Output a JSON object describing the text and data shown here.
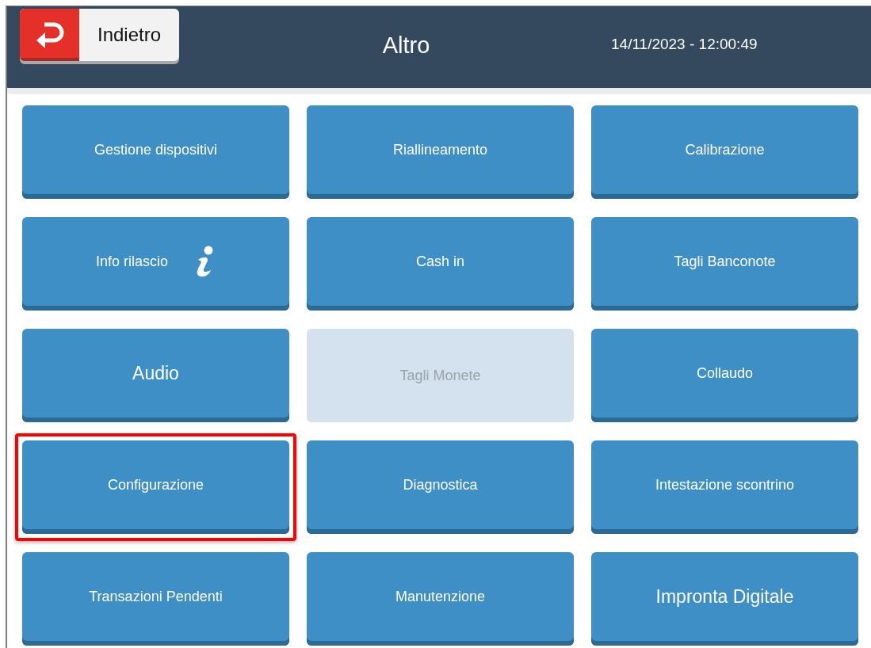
{
  "header": {
    "back_button": "Indietro",
    "title": "Altro",
    "datetime": "14/11/2023 - 12:00:49"
  },
  "buttons": [
    {
      "label": "Gestione dispositivi",
      "kind": "plain",
      "large": false,
      "disabled": false,
      "highlighted": false
    },
    {
      "label": "Riallineamento",
      "kind": "plain",
      "large": false,
      "disabled": false,
      "highlighted": false
    },
    {
      "label": "Calibrazione",
      "kind": "plain",
      "large": false,
      "disabled": false,
      "highlighted": false
    },
    {
      "label": "Info rilascio",
      "kind": "info",
      "large": false,
      "disabled": false,
      "highlighted": false
    },
    {
      "label": "Cash in",
      "kind": "plain",
      "large": false,
      "disabled": false,
      "highlighted": false
    },
    {
      "label": "Tagli Banconote",
      "kind": "plain",
      "large": false,
      "disabled": false,
      "highlighted": false
    },
    {
      "label": "Audio",
      "kind": "plain",
      "large": true,
      "disabled": false,
      "highlighted": false
    },
    {
      "label": "Tagli Monete",
      "kind": "plain",
      "large": false,
      "disabled": true,
      "highlighted": false
    },
    {
      "label": "Collaudo",
      "kind": "plain",
      "large": false,
      "disabled": false,
      "highlighted": false
    },
    {
      "label": "Configurazione",
      "kind": "plain",
      "large": false,
      "disabled": false,
      "highlighted": true
    },
    {
      "label": "Diagnostica",
      "kind": "plain",
      "large": false,
      "disabled": false,
      "highlighted": false
    },
    {
      "label": "Intestazione scontrino",
      "kind": "plain",
      "large": false,
      "disabled": false,
      "highlighted": false
    },
    {
      "label": "Transazioni Pendenti",
      "kind": "plain",
      "large": false,
      "disabled": false,
      "highlighted": false
    },
    {
      "label": "Manutenzione",
      "kind": "plain",
      "large": false,
      "disabled": false,
      "highlighted": false
    },
    {
      "label": "Impronta Digitale",
      "kind": "plain",
      "large": true,
      "disabled": false,
      "highlighted": false
    }
  ]
}
